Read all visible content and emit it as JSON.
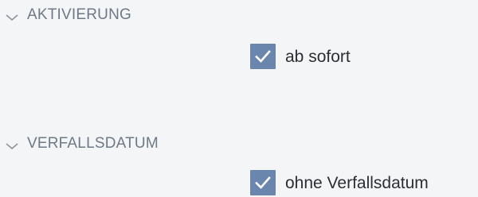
{
  "sections": {
    "activation": {
      "title": "AKTIVIERUNG",
      "option_label": "ab sofort",
      "checked": true
    },
    "expiry": {
      "title": "VERFALLSDATUM",
      "option_label": "ohne Verfallsdatum",
      "checked": true
    }
  },
  "icons": {
    "collapse": "chevron-down-icon",
    "check": "checkmark-icon"
  },
  "colors": {
    "background": "#f4f5f7",
    "header_text": "#6f7985",
    "checkbox_fill": "#6b86ad",
    "label_text": "#2b2f33"
  }
}
